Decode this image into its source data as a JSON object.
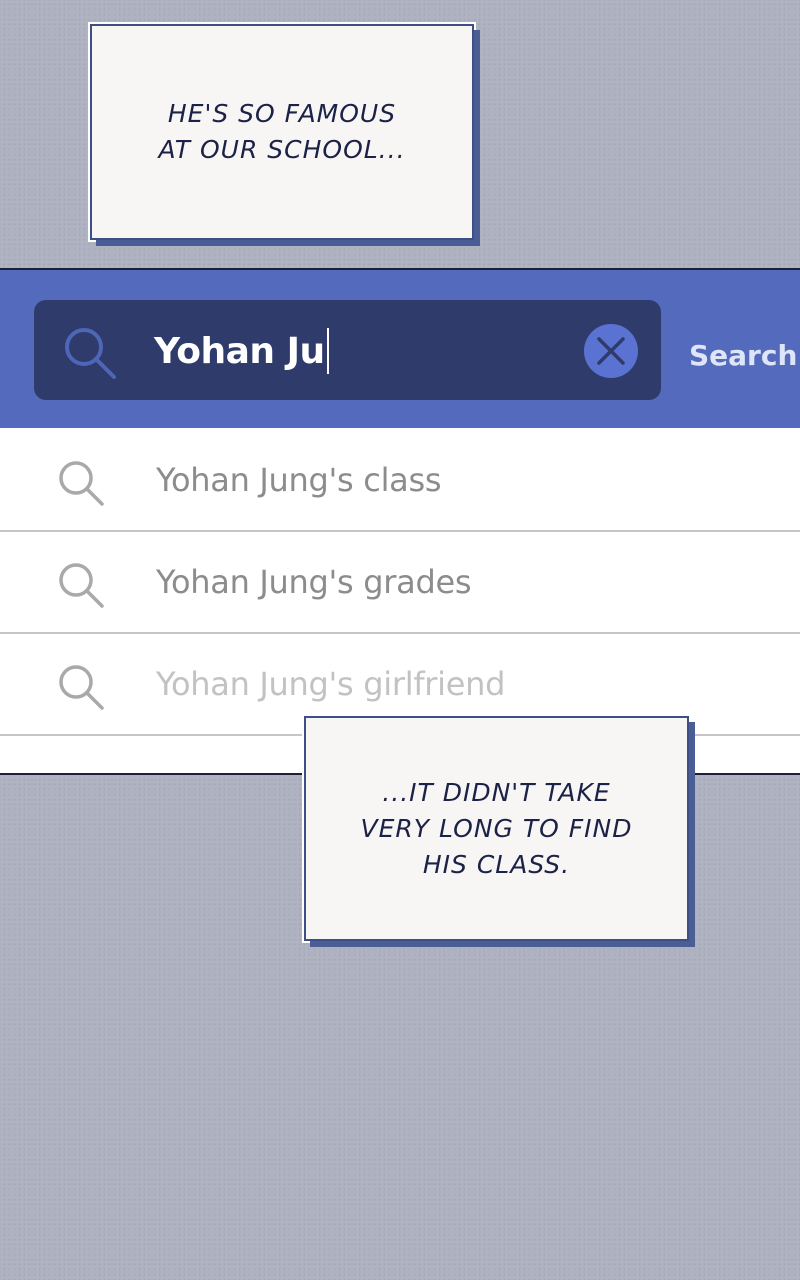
{
  "captions": {
    "top": "HE'S SO FAMOUS\nAT OUR SCHOOL...",
    "bottom": "...IT DIDN'T TAKE\nVERY LONG TO FIND\nHIS CLASS."
  },
  "search": {
    "query": "Yohan Ju",
    "action_label": "Search",
    "search_icon": "search-icon",
    "clear_icon": "close-icon",
    "colors": {
      "header": "#536abd",
      "box": "#2f3b6b",
      "clear": "#5a73d2"
    }
  },
  "suggestions": [
    {
      "label": "Yohan Jung's class",
      "icon": "search-icon"
    },
    {
      "label": "Yohan Jung's grades",
      "icon": "search-icon"
    },
    {
      "label": "Yohan Jung's girlfriend",
      "icon": "search-icon"
    }
  ]
}
